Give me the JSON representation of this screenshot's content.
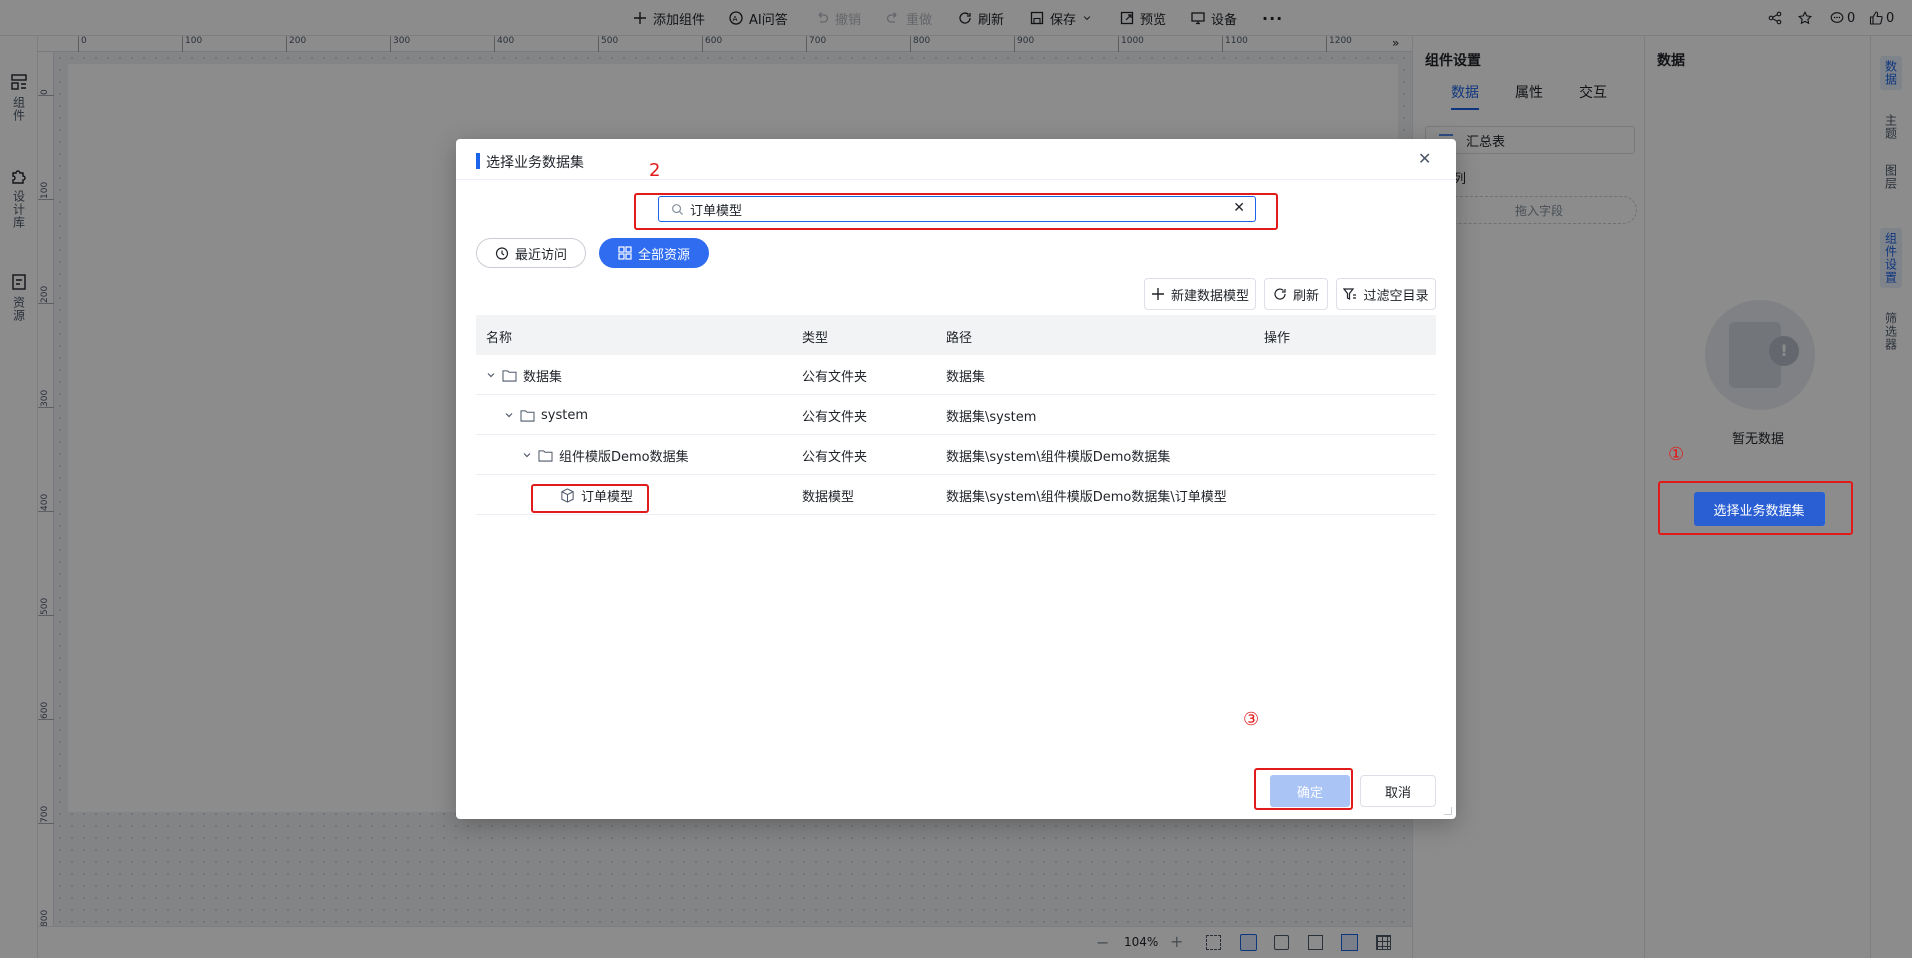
{
  "toolbar": {
    "add_component": "添加组件",
    "ai_qa": "AI问答",
    "undo": "撤销",
    "redo": "重做",
    "refresh": "刷新",
    "save": "保存",
    "preview": "预览",
    "device": "设备",
    "comment_count": "0",
    "like_count": "0"
  },
  "left_sidebar": {
    "items": [
      {
        "label": "组件",
        "icon": "component-icon"
      },
      {
        "label": "设计库",
        "icon": "puzzle-icon"
      },
      {
        "label": "资源",
        "icon": "resource-icon"
      }
    ]
  },
  "ruler": {
    "top_ticks": [
      "0",
      "100",
      "200",
      "300",
      "400",
      "500",
      "600",
      "700",
      "800",
      "900",
      "1000",
      "1100",
      "1200"
    ],
    "left_ticks": [
      "0",
      "100",
      "200",
      "300",
      "400",
      "500",
      "600",
      "700",
      "800"
    ]
  },
  "zoom": {
    "value": "104%"
  },
  "component_settings": {
    "title": "组件设置",
    "tabs": [
      "数据",
      "属性",
      "交互"
    ],
    "active_tab": "数据",
    "summary_table_label": "汇总表",
    "columns_label": "列",
    "drop_field_placeholder": "拖入字段"
  },
  "data_panel": {
    "title": "数据",
    "empty_text": "暂无数据",
    "select_dataset_button": "选择业务数据集"
  },
  "right_rail": {
    "items": [
      "数据",
      "主题",
      "图层",
      "组件设置",
      "筛选器"
    ]
  },
  "modal": {
    "title": "选择业务数据集",
    "search_value": "订单模型",
    "filters": {
      "recent": "最近访问",
      "all": "全部资源",
      "active": "all"
    },
    "actions": {
      "new_model": "新建数据模型",
      "refresh": "刷新",
      "filter_empty": "过滤空目录"
    },
    "columns": [
      "名称",
      "类型",
      "路径",
      "操作"
    ],
    "rows": [
      {
        "name": "数据集",
        "type": "公有文件夹",
        "path": "数据集",
        "level": 0,
        "kind": "folder"
      },
      {
        "name": "system",
        "type": "公有文件夹",
        "path": "数据集\\system",
        "level": 1,
        "kind": "folder"
      },
      {
        "name": "组件模版Demo数据集",
        "type": "公有文件夹",
        "path": "数据集\\system\\组件模版Demo数据集",
        "level": 2,
        "kind": "folder"
      },
      {
        "name": "订单模型",
        "type": "数据模型",
        "path": "数据集\\system\\组件模版Demo数据集\\订单模型",
        "level": 3,
        "kind": "model"
      }
    ],
    "confirm": "确定",
    "cancel": "取消"
  },
  "annotations": {
    "step1": "①",
    "step2": "2",
    "step3": "③"
  },
  "colors": {
    "primary": "#1b63e8",
    "annotation_red": "#e11b1b",
    "confirm_disabled": "#a9c4f5"
  }
}
